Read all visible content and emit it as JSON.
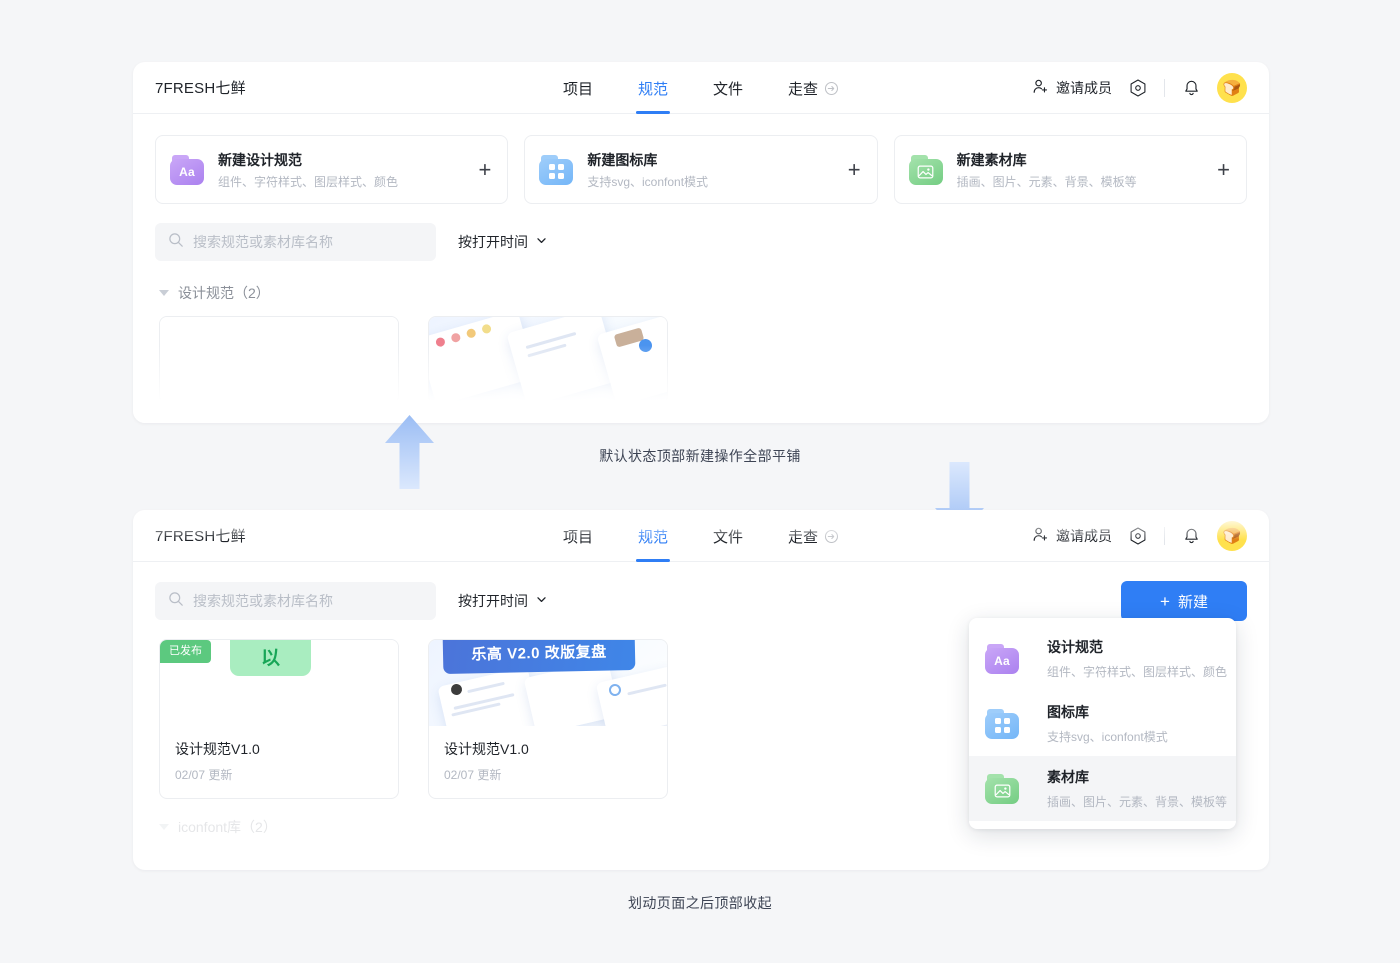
{
  "header": {
    "brand": "7FRESH七鲜",
    "nav": [
      {
        "label": "项目",
        "active": false,
        "trailing_icon": ""
      },
      {
        "label": "规范",
        "active": true,
        "trailing_icon": ""
      },
      {
        "label": "文件",
        "active": false,
        "trailing_icon": ""
      },
      {
        "label": "走查",
        "active": false,
        "trailing_icon": "arrow-enter-icon"
      }
    ],
    "invite_label": "邀请成员",
    "invite_icon": "user-add-icon",
    "settings_icon": "hexagon-target-icon",
    "bell_icon": "bell-icon",
    "avatar_icon": "avatar-food-emoji",
    "avatar_color": "#ffe14d",
    "accent_color": "#2f7ef5"
  },
  "create_cards": [
    {
      "title": "新建设计规范",
      "subtitle": "组件、字符样式、图层样式、颜色",
      "icon": "folder-aa-icon",
      "icon_label": "Aa",
      "color": "#b38bf0",
      "color_light": "#c9a6f7",
      "plus": "+"
    },
    {
      "title": "新建图标库",
      "subtitle": "支持svg、iconfont模式",
      "icon": "folder-grid-icon",
      "icon_label": "",
      "color": "#7fbcf8",
      "color_light": "#9ecdfa",
      "plus": "+"
    },
    {
      "title": "新建素材库",
      "subtitle": "插画、图片、元素、背景、模板等",
      "icon": "folder-image-icon",
      "icon_label": "",
      "color": "#84d68f",
      "color_light": "#a3e2ab",
      "plus": "+"
    }
  ],
  "toolbar": {
    "search_placeholder": "搜索规范或素材库名称",
    "search_value": "",
    "search_icon": "search-icon",
    "sort_label": "按打开时间",
    "sort_icon": "chevron-down-icon",
    "new_button_label": "新建",
    "new_button_plus": "+"
  },
  "groups": {
    "top_label": "设计规范（2）",
    "bottom_label": "iconfont库（2）"
  },
  "library_cards": [
    {
      "name": "设计规范V1.0",
      "date": "02/07 更新",
      "badge": "已发布",
      "badge_color": "#5cc97f",
      "thumb_text": "以"
    },
    {
      "name": "设计规范V1.0",
      "date": "02/07 更新",
      "badge": "",
      "badge_color": "",
      "thumb_text": "乐高 V2.0 改版复盘"
    }
  ],
  "menu": {
    "items": [
      {
        "title": "设计规范",
        "subtitle": "组件、字符样式、图层样式、颜色",
        "icon": "folder-aa-icon",
        "icon_label": "Aa",
        "color": "#b38bf0",
        "color_light": "#c9a6f7",
        "hover": false
      },
      {
        "title": "图标库",
        "subtitle": "支持svg、iconfont模式",
        "icon": "folder-grid-icon",
        "icon_label": "",
        "color": "#7fbcf8",
        "color_light": "#9ecdfa",
        "hover": false
      },
      {
        "title": "素材库",
        "subtitle": "插画、图片、元素、背景、模板等",
        "icon": "folder-image-icon",
        "icon_label": "",
        "color": "#84d68f",
        "color_light": "#a3e2ab",
        "hover": true
      }
    ]
  },
  "annotations": {
    "top": "默认状态顶部新建操作全部平铺",
    "bottom": "划动页面之后顶部收起",
    "arrow_up_icon": "arrow-up-icon",
    "arrow_down_icon": "arrow-down-icon",
    "arrow_color": "#a9c6f5"
  }
}
